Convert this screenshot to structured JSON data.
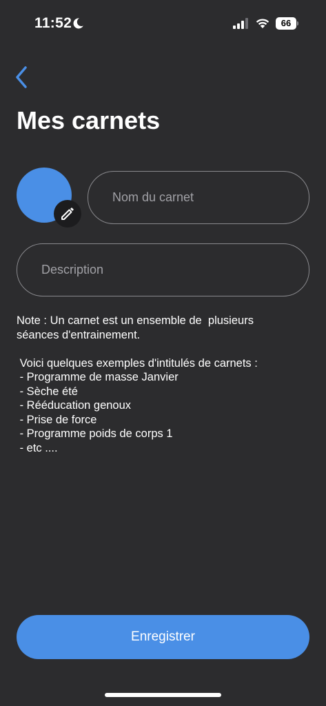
{
  "status_bar": {
    "time": "11:52",
    "battery_level": "66",
    "icons": [
      "moon-icon",
      "signal-icon",
      "wifi-icon",
      "battery-icon"
    ]
  },
  "header": {
    "back_icon": "chevron-left-icon",
    "title": "Mes carnets"
  },
  "form": {
    "avatar_color": "#4a8fe6",
    "edit_icon": "pencil-icon",
    "name_placeholder": "Nom du carnet",
    "name_value": "",
    "description_placeholder": "Description",
    "description_value": ""
  },
  "note": {
    "lines": [
      "Note : Un carnet est un ensemble de  plusieurs",
      "séances d'entrainement.",
      "",
      " Voici quelques exemples d'intitulés de carnets :",
      " - Programme de masse Janvier",
      " - Sèche été",
      " - Rééducation genoux",
      " - Prise de force",
      " - Programme poids de corps 1",
      " - etc ...."
    ]
  },
  "actions": {
    "save_label": "Enregistrer"
  },
  "colors": {
    "background": "#2c2c2e",
    "accent": "#4a8fe6",
    "field_border": "#8a8a8e"
  }
}
